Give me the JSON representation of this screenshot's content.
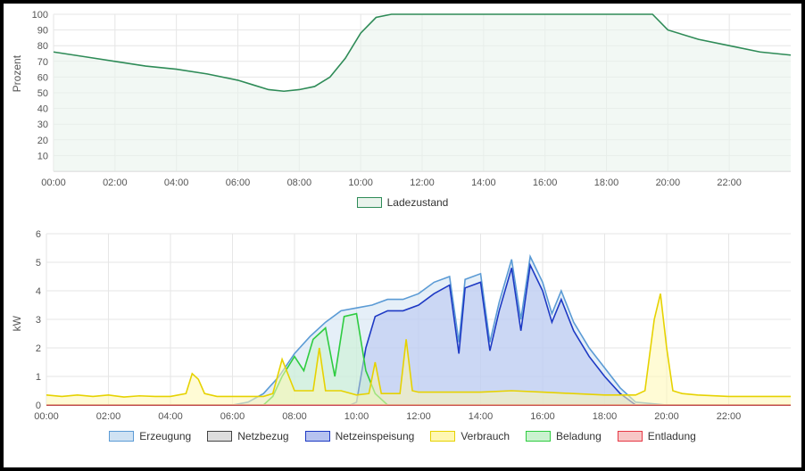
{
  "top": {
    "ylabel": "Prozent",
    "legend": [
      "Ladezustand"
    ],
    "colors": {
      "Ladezustand": {
        "stroke": "#2e8b57",
        "fill": "#e9f3ec"
      }
    }
  },
  "bottom": {
    "ylabel": "kW",
    "legend": [
      "Erzeugung",
      "Netzbezug",
      "Netzeinspeisung",
      "Verbrauch",
      "Beladung",
      "Entladung"
    ],
    "colors": {
      "Erzeugung": {
        "stroke": "#5b9bd5",
        "fill": "#cfe2f3"
      },
      "Netzbezug": {
        "stroke": "#444444",
        "fill": "#dddddd"
      },
      "Netzeinspeisung": {
        "stroke": "#1d39c4",
        "fill": "#b6c2f0"
      },
      "Verbrauch": {
        "stroke": "#e6d200",
        "fill": "#fff7b2"
      },
      "Beladung": {
        "stroke": "#2ecc40",
        "fill": "#caf2cf"
      },
      "Entladung": {
        "stroke": "#e63946",
        "fill": "#f7c6c6"
      }
    }
  },
  "chart_data": [
    {
      "type": "area",
      "title": "",
      "xlabel": "",
      "ylabel": "Prozent",
      "xlim": [
        0,
        24
      ],
      "ylim": [
        0,
        100
      ],
      "x_ticks": [
        "00:00",
        "02:00",
        "04:00",
        "06:00",
        "08:00",
        "10:00",
        "12:00",
        "14:00",
        "16:00",
        "18:00",
        "20:00",
        "22:00"
      ],
      "x_tick_vals": [
        0,
        2,
        4,
        6,
        8,
        10,
        12,
        14,
        16,
        18,
        20,
        22
      ],
      "y_ticks": [
        10,
        20,
        30,
        40,
        50,
        60,
        70,
        80,
        90,
        100
      ],
      "series": [
        {
          "name": "Ladezustand",
          "x": [
            0,
            1,
            2,
            3,
            4,
            5,
            6,
            6.5,
            7,
            7.5,
            8,
            8.5,
            9,
            9.5,
            10,
            10.5,
            11,
            12,
            13,
            14,
            15,
            16,
            17,
            18,
            19,
            19.5,
            20,
            21,
            22,
            23,
            24
          ],
          "y": [
            76,
            73,
            70,
            67,
            65,
            62,
            58,
            55,
            52,
            51,
            52,
            54,
            60,
            72,
            88,
            98,
            100,
            100,
            100,
            100,
            100,
            100,
            100,
            100,
            100,
            100,
            90,
            84,
            80,
            76,
            74
          ]
        }
      ]
    },
    {
      "type": "area",
      "title": "",
      "xlabel": "",
      "ylabel": "kW",
      "xlim": [
        0,
        24
      ],
      "ylim": [
        0,
        6
      ],
      "x_ticks": [
        "00:00",
        "02:00",
        "04:00",
        "06:00",
        "08:00",
        "10:00",
        "12:00",
        "14:00",
        "16:00",
        "18:00",
        "20:00",
        "22:00"
      ],
      "x_tick_vals": [
        0,
        2,
        4,
        6,
        8,
        10,
        12,
        14,
        16,
        18,
        20,
        22
      ],
      "y_ticks": [
        0,
        1,
        2,
        3,
        4,
        5,
        6
      ],
      "series": [
        {
          "name": "Erzeugung",
          "x": [
            0,
            6,
            6.5,
            7,
            7.5,
            8,
            8.5,
            9,
            9.5,
            10,
            10.5,
            11,
            11.5,
            12,
            12.5,
            13,
            13.3,
            13.5,
            14,
            14.3,
            14.6,
            15,
            15.3,
            15.6,
            16,
            16.3,
            16.6,
            17,
            17.5,
            18,
            18.5,
            19,
            20,
            24
          ],
          "y": [
            0,
            0,
            0.1,
            0.4,
            1.0,
            1.8,
            2.4,
            2.9,
            3.3,
            3.4,
            3.5,
            3.7,
            3.7,
            3.9,
            4.3,
            4.5,
            2.2,
            4.4,
            4.6,
            2.2,
            3.6,
            5.1,
            3.0,
            5.2,
            4.3,
            3.2,
            4.0,
            2.9,
            2.0,
            1.3,
            0.6,
            0.1,
            0,
            0
          ]
        },
        {
          "name": "Beladung",
          "x": [
            0,
            7,
            7.3,
            7.6,
            8,
            8.3,
            8.6,
            9,
            9.3,
            9.6,
            10,
            10.3,
            10.6,
            11,
            24
          ],
          "y": [
            0,
            0,
            0.3,
            1.0,
            1.7,
            1.2,
            2.3,
            2.7,
            1.0,
            3.1,
            3.2,
            1.2,
            0.4,
            0,
            0
          ]
        },
        {
          "name": "Netzeinspeisung",
          "x": [
            0,
            9.8,
            10,
            10.3,
            10.6,
            11,
            11.5,
            12,
            12.5,
            13,
            13.3,
            13.5,
            14,
            14.3,
            14.6,
            15,
            15.3,
            15.6,
            16,
            16.3,
            16.6,
            17,
            17.5,
            18,
            18.5,
            19,
            24
          ],
          "y": [
            0,
            0,
            0.1,
            2.0,
            3.1,
            3.3,
            3.3,
            3.5,
            3.9,
            4.2,
            1.8,
            4.1,
            4.3,
            1.9,
            3.3,
            4.8,
            2.6,
            4.9,
            4.0,
            2.9,
            3.7,
            2.6,
            1.7,
            1.0,
            0.4,
            0,
            0
          ]
        },
        {
          "name": "Netzbezug",
          "x": [
            0,
            24
          ],
          "y": [
            0,
            0
          ]
        },
        {
          "name": "Entladung",
          "x": [
            0,
            24
          ],
          "y": [
            0,
            0
          ]
        },
        {
          "name": "Verbrauch",
          "x": [
            0,
            0.5,
            1,
            1.5,
            2,
            2.5,
            3,
            3.5,
            4,
            4.5,
            4.7,
            4.9,
            5.1,
            5.5,
            6,
            6.5,
            7,
            7.3,
            7.6,
            8,
            8.3,
            8.6,
            8.8,
            9,
            9.5,
            10,
            10.4,
            10.6,
            10.8,
            11,
            11.4,
            11.6,
            11.8,
            12,
            13,
            14,
            15,
            16,
            17,
            18,
            19,
            19.3,
            19.6,
            19.8,
            20,
            20.2,
            20.5,
            21,
            22,
            23,
            24
          ],
          "y": [
            0.35,
            0.3,
            0.35,
            0.3,
            0.35,
            0.28,
            0.32,
            0.3,
            0.3,
            0.4,
            1.1,
            0.9,
            0.4,
            0.3,
            0.3,
            0.3,
            0.3,
            0.4,
            1.6,
            0.5,
            0.5,
            0.5,
            2.0,
            0.5,
            0.5,
            0.35,
            0.4,
            1.5,
            0.4,
            0.4,
            0.4,
            2.3,
            0.5,
            0.45,
            0.45,
            0.45,
            0.5,
            0.45,
            0.4,
            0.35,
            0.35,
            0.5,
            3.0,
            3.9,
            2.0,
            0.5,
            0.4,
            0.35,
            0.3,
            0.3,
            0.3
          ]
        }
      ]
    }
  ]
}
